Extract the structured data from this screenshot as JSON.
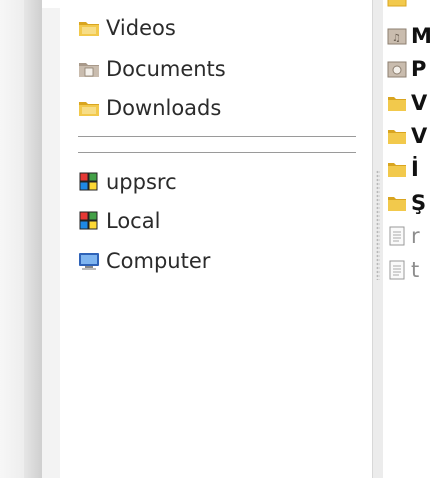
{
  "places": {
    "items": [
      {
        "label": "Videos",
        "icon": "video-folder-icon"
      },
      {
        "label": "Documents",
        "icon": "documents-folder-icon"
      },
      {
        "label": "Downloads",
        "icon": "downloads-folder-icon"
      }
    ],
    "shortcuts": [
      {
        "label": "uppsrc",
        "icon": "package-icon"
      },
      {
        "label": "Local",
        "icon": "package-icon"
      },
      {
        "label": "Computer",
        "icon": "computer-icon"
      }
    ]
  },
  "files": {
    "items": [
      {
        "label": "M",
        "icon": "music-folder-icon"
      },
      {
        "label": "P",
        "icon": "pictures-folder-icon"
      },
      {
        "label": "V",
        "icon": "folder-icon"
      },
      {
        "label": "V",
        "icon": "folder-icon"
      },
      {
        "label": "İ",
        "icon": "folder-icon"
      },
      {
        "label": "Ş",
        "icon": "folder-icon"
      },
      {
        "label": "r",
        "icon": "text-file-icon"
      },
      {
        "label": "t",
        "icon": "text-file-icon"
      }
    ]
  },
  "colors": {
    "folder": "#f2c94c",
    "folder_dark": "#d9a520",
    "link": "#1a1aff"
  }
}
